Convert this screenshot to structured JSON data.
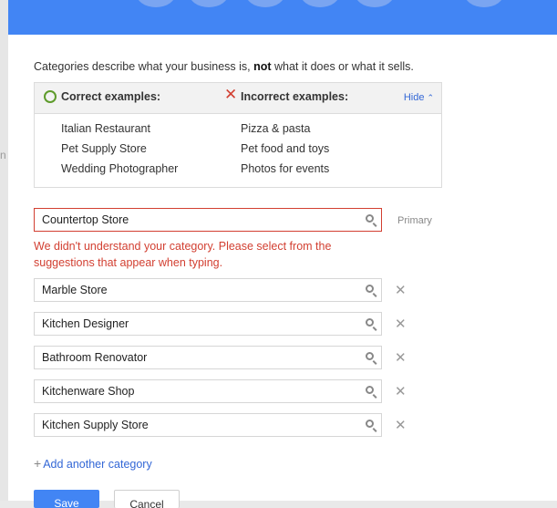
{
  "left_glyph": "n",
  "intro": {
    "text_before": "Categories describe what your business is, ",
    "text_bold": "not",
    "text_after": " what it does or what it sells."
  },
  "examples": {
    "correct_label": "Correct examples:",
    "incorrect_label": "Incorrect examples:",
    "hide_label": "Hide",
    "hide_chevron": "⌃",
    "correct": [
      "Italian Restaurant",
      "Pet Supply Store",
      "Wedding Photographer"
    ],
    "incorrect": [
      "Pizza & pasta",
      "Pet food and toys",
      "Photos for events"
    ]
  },
  "categories": [
    {
      "value": "Countertop Store"
    },
    {
      "value": "Marble Store"
    },
    {
      "value": "Kitchen Designer"
    },
    {
      "value": "Bathroom Renovator"
    },
    {
      "value": "Kitchenware Shop"
    },
    {
      "value": "Kitchen Supply Store"
    }
  ],
  "primary_label": "Primary",
  "error_message": "We didn't understand your category. Please select from the suggestions that appear when typing.",
  "remove_glyph": "✕",
  "add_link": {
    "plus": "+",
    "label": "Add another category"
  },
  "buttons": {
    "save": "Save",
    "cancel": "Cancel"
  },
  "colors": {
    "accent": "#4285f4",
    "link": "#3367d6",
    "error": "#d23f31",
    "ok": "#5e9b2b"
  },
  "icons": [
    "search-icon",
    "remove-icon",
    "correct-circle-icon",
    "incorrect-x-icon",
    "chevron-up-icon",
    "plus-icon"
  ]
}
